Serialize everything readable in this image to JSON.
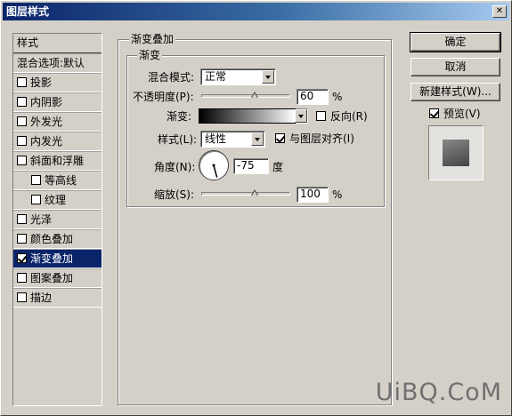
{
  "window": {
    "title": "图层样式",
    "close_glyph": "✕"
  },
  "left_panel": {
    "header": "样式",
    "items": [
      {
        "label": "混合选项:默认",
        "checkbox": false,
        "checked": false,
        "indent": false,
        "selected": false
      },
      {
        "label": "投影",
        "checkbox": true,
        "checked": false,
        "indent": false,
        "selected": false
      },
      {
        "label": "内阴影",
        "checkbox": true,
        "checked": false,
        "indent": false,
        "selected": false
      },
      {
        "label": "外发光",
        "checkbox": true,
        "checked": false,
        "indent": false,
        "selected": false
      },
      {
        "label": "内发光",
        "checkbox": true,
        "checked": false,
        "indent": false,
        "selected": false
      },
      {
        "label": "斜面和浮雕",
        "checkbox": true,
        "checked": false,
        "indent": false,
        "selected": false
      },
      {
        "label": "等高线",
        "checkbox": true,
        "checked": false,
        "indent": true,
        "selected": false
      },
      {
        "label": "纹理",
        "checkbox": true,
        "checked": false,
        "indent": true,
        "selected": false
      },
      {
        "label": "光泽",
        "checkbox": true,
        "checked": false,
        "indent": false,
        "selected": false
      },
      {
        "label": "颜色叠加",
        "checkbox": true,
        "checked": false,
        "indent": false,
        "selected": false
      },
      {
        "label": "渐变叠加",
        "checkbox": true,
        "checked": true,
        "indent": false,
        "selected": true
      },
      {
        "label": "图案叠加",
        "checkbox": true,
        "checked": false,
        "indent": false,
        "selected": false
      },
      {
        "label": "描边",
        "checkbox": true,
        "checked": false,
        "indent": false,
        "selected": false
      }
    ]
  },
  "gradient_overlay": {
    "title": "渐变叠加",
    "inner_title": "渐变",
    "blend_mode_label": "混合模式:",
    "blend_mode_value": "正常",
    "opacity_label": "不透明度(P):",
    "opacity_value": "60",
    "opacity_level": 0.6,
    "percent": "%",
    "gradient_label": "渐变:",
    "reverse_label": "反向(R)",
    "reverse_checked": false,
    "style_label": "样式(L):",
    "style_value": "线性",
    "align_label": "与图层对齐(I)",
    "align_checked": true,
    "angle_label": "角度(N):",
    "angle_value": "-75",
    "angle_degrees": -75,
    "angle_unit": "度",
    "scale_label": "缩放(S):",
    "scale_value": "100",
    "scale_level": 0.6
  },
  "buttons": {
    "ok": "确定",
    "cancel": "取消",
    "new_style": "新建样式(W)...",
    "preview_label": "预览(V)",
    "preview_checked": true
  },
  "watermark": "UiBQ.CoM"
}
